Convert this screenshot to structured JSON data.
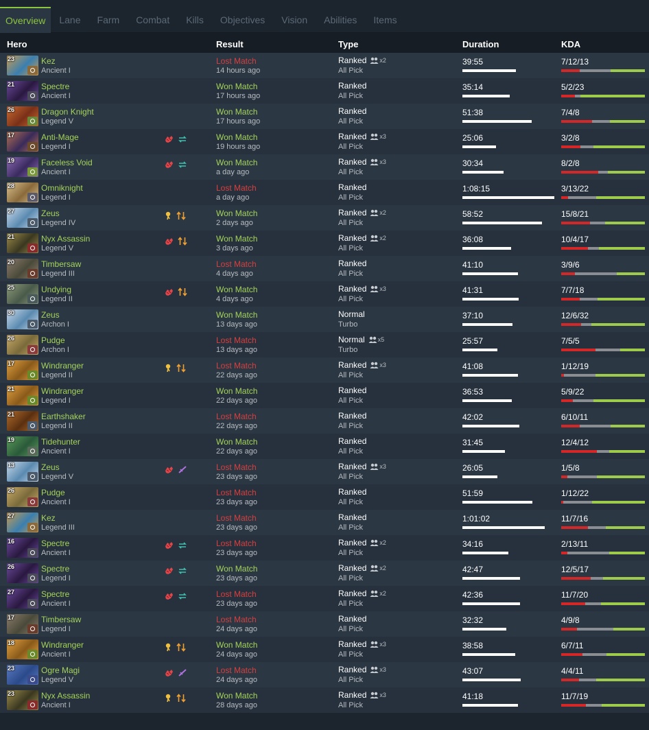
{
  "tabs": [
    "Overview",
    "Lane",
    "Farm",
    "Combat",
    "Kills",
    "Objectives",
    "Vision",
    "Abilities",
    "Items"
  ],
  "active_tab": "Overview",
  "columns": {
    "hero": "Hero",
    "result": "Result",
    "type": "Type",
    "duration": "Duration",
    "kda": "KDA"
  },
  "colors": {
    "won": "#a5d35b",
    "lost": "#d64040",
    "kills": "#d42828",
    "deaths": "#8a8e92",
    "assists": "#9ecb4c"
  },
  "matches": [
    {
      "level": "23",
      "hero": "Kez",
      "rank": "Ancient I",
      "result": "Lost Match",
      "won": false,
      "ago": "14 hours ago",
      "type": "Ranked",
      "party": "x2",
      "mode": "All Pick",
      "duration": "39:55",
      "kda": "7/12/13",
      "icons": []
    },
    {
      "level": "21",
      "hero": "Spectre",
      "rank": "Ancient I",
      "result": "Won Match",
      "won": true,
      "ago": "17 hours ago",
      "type": "Ranked",
      "party": "",
      "mode": "All Pick",
      "duration": "35:14",
      "kda": "5/2/23",
      "icons": []
    },
    {
      "level": "26",
      "hero": "Dragon Knight",
      "rank": "Legend V",
      "result": "Won Match",
      "won": true,
      "ago": "17 hours ago",
      "type": "Ranked",
      "party": "",
      "mode": "All Pick",
      "duration": "51:38",
      "kda": "7/4/8",
      "icons": []
    },
    {
      "level": "17",
      "hero": "Anti-Mage",
      "rank": "Legend I",
      "result": "Won Match",
      "won": true,
      "ago": "19 hours ago",
      "type": "Ranked",
      "party": "x3",
      "mode": "All Pick",
      "duration": "25:06",
      "kda": "3/2/8",
      "icons": [
        "fist",
        "swap"
      ]
    },
    {
      "level": "19",
      "hero": "Faceless Void",
      "rank": "Ancient I",
      "result": "Won Match",
      "won": true,
      "ago": "a day ago",
      "type": "Ranked",
      "party": "x3",
      "mode": "All Pick",
      "duration": "30:34",
      "kda": "8/2/8",
      "icons": [
        "fist",
        "swap"
      ]
    },
    {
      "level": "28",
      "hero": "Omniknight",
      "rank": "Legend I",
      "result": "Lost Match",
      "won": false,
      "ago": "a day ago",
      "type": "Ranked",
      "party": "",
      "mode": "All Pick",
      "duration": "1:08:15",
      "kda": "3/13/22",
      "icons": []
    },
    {
      "level": "27",
      "hero": "Zeus",
      "rank": "Legend IV",
      "result": "Won Match",
      "won": true,
      "ago": "2 days ago",
      "type": "Ranked",
      "party": "x2",
      "mode": "All Pick",
      "duration": "58:52",
      "kda": "15/8/21",
      "icons": [
        "hand",
        "updown"
      ]
    },
    {
      "level": "21",
      "hero": "Nyx Assassin",
      "rank": "Legend V",
      "result": "Won Match",
      "won": true,
      "ago": "3 days ago",
      "type": "Ranked",
      "party": "x2",
      "mode": "All Pick",
      "duration": "36:08",
      "kda": "10/4/17",
      "icons": [
        "fist",
        "updown"
      ]
    },
    {
      "level": "20",
      "hero": "Timbersaw",
      "rank": "Legend III",
      "result": "Lost Match",
      "won": false,
      "ago": "4 days ago",
      "type": "Ranked",
      "party": "",
      "mode": "All Pick",
      "duration": "41:10",
      "kda": "3/9/6",
      "icons": []
    },
    {
      "level": "25",
      "hero": "Undying",
      "rank": "Legend II",
      "result": "Won Match",
      "won": true,
      "ago": "4 days ago",
      "type": "Ranked",
      "party": "x3",
      "mode": "All Pick",
      "duration": "41:31",
      "kda": "7/7/18",
      "icons": [
        "fist",
        "updown"
      ]
    },
    {
      "level": "30",
      "hero": "Zeus",
      "rank": "Archon I",
      "result": "Won Match",
      "won": true,
      "ago": "13 days ago",
      "type": "Normal",
      "party": "",
      "mode": "Turbo",
      "duration": "37:10",
      "kda": "12/6/32",
      "icons": []
    },
    {
      "level": "26",
      "hero": "Pudge",
      "rank": "Archon I",
      "result": "Lost Match",
      "won": false,
      "ago": "13 days ago",
      "type": "Normal",
      "party": "x5",
      "mode": "Turbo",
      "duration": "25:57",
      "kda": "7/5/5",
      "icons": []
    },
    {
      "level": "17",
      "hero": "Windranger",
      "rank": "Legend II",
      "result": "Lost Match",
      "won": false,
      "ago": "22 days ago",
      "type": "Ranked",
      "party": "x3",
      "mode": "All Pick",
      "duration": "41:08",
      "kda": "1/12/19",
      "icons": [
        "hand",
        "updown"
      ]
    },
    {
      "level": "21",
      "hero": "Windranger",
      "rank": "Legend I",
      "result": "Won Match",
      "won": true,
      "ago": "22 days ago",
      "type": "Ranked",
      "party": "",
      "mode": "All Pick",
      "duration": "36:53",
      "kda": "5/9/22",
      "icons": []
    },
    {
      "level": "21",
      "hero": "Earthshaker",
      "rank": "Legend II",
      "result": "Lost Match",
      "won": false,
      "ago": "22 days ago",
      "type": "Ranked",
      "party": "",
      "mode": "All Pick",
      "duration": "42:02",
      "kda": "6/10/11",
      "icons": []
    },
    {
      "level": "19",
      "hero": "Tidehunter",
      "rank": "Ancient I",
      "result": "Won Match",
      "won": true,
      "ago": "22 days ago",
      "type": "Ranked",
      "party": "",
      "mode": "All Pick",
      "duration": "31:45",
      "kda": "12/4/12",
      "icons": []
    },
    {
      "level": "13",
      "hero": "Zeus",
      "rank": "Legend V",
      "result": "Lost Match",
      "won": false,
      "ago": "23 days ago",
      "type": "Ranked",
      "party": "x3",
      "mode": "All Pick",
      "duration": "26:05",
      "kda": "1/5/8",
      "icons": [
        "fist",
        "sword"
      ]
    },
    {
      "level": "26",
      "hero": "Pudge",
      "rank": "Ancient I",
      "result": "Lost Match",
      "won": false,
      "ago": "23 days ago",
      "type": "Ranked",
      "party": "",
      "mode": "All Pick",
      "duration": "51:59",
      "kda": "1/12/22",
      "icons": []
    },
    {
      "level": "27",
      "hero": "Kez",
      "rank": "Legend III",
      "result": "Lost Match",
      "won": false,
      "ago": "23 days ago",
      "type": "Ranked",
      "party": "",
      "mode": "All Pick",
      "duration": "1:01:02",
      "kda": "11/7/16",
      "icons": []
    },
    {
      "level": "16",
      "hero": "Spectre",
      "rank": "Ancient I",
      "result": "Lost Match",
      "won": false,
      "ago": "23 days ago",
      "type": "Ranked",
      "party": "x2",
      "mode": "All Pick",
      "duration": "34:16",
      "kda": "2/13/11",
      "icons": [
        "fist",
        "swap"
      ]
    },
    {
      "level": "26",
      "hero": "Spectre",
      "rank": "Legend I",
      "result": "Won Match",
      "won": true,
      "ago": "23 days ago",
      "type": "Ranked",
      "party": "x2",
      "mode": "All Pick",
      "duration": "42:47",
      "kda": "12/5/17",
      "icons": [
        "fist",
        "swap"
      ]
    },
    {
      "level": "27",
      "hero": "Spectre",
      "rank": "Ancient I",
      "result": "Lost Match",
      "won": false,
      "ago": "23 days ago",
      "type": "Ranked",
      "party": "x2",
      "mode": "All Pick",
      "duration": "42:36",
      "kda": "11/7/20",
      "icons": [
        "fist",
        "swap"
      ]
    },
    {
      "level": "17",
      "hero": "Timbersaw",
      "rank": "Legend I",
      "result": "Lost Match",
      "won": false,
      "ago": "24 days ago",
      "type": "Ranked",
      "party": "",
      "mode": "All Pick",
      "duration": "32:32",
      "kda": "4/9/8",
      "icons": []
    },
    {
      "level": "18",
      "hero": "Windranger",
      "rank": "Ancient I",
      "result": "Won Match",
      "won": true,
      "ago": "24 days ago",
      "type": "Ranked",
      "party": "x3",
      "mode": "All Pick",
      "duration": "38:58",
      "kda": "6/7/11",
      "icons": [
        "hand",
        "updown"
      ]
    },
    {
      "level": "23",
      "hero": "Ogre Magi",
      "rank": "Legend V",
      "result": "Lost Match",
      "won": false,
      "ago": "24 days ago",
      "type": "Ranked",
      "party": "x3",
      "mode": "All Pick",
      "duration": "43:07",
      "kda": "4/4/11",
      "icons": [
        "fist",
        "sword"
      ]
    },
    {
      "level": "23",
      "hero": "Nyx Assassin",
      "rank": "Ancient I",
      "result": "Won Match",
      "won": true,
      "ago": "28 days ago",
      "type": "Ranked",
      "party": "x3",
      "mode": "All Pick",
      "duration": "41:18",
      "kda": "11/7/19",
      "icons": [
        "hand",
        "updown"
      ]
    }
  ]
}
